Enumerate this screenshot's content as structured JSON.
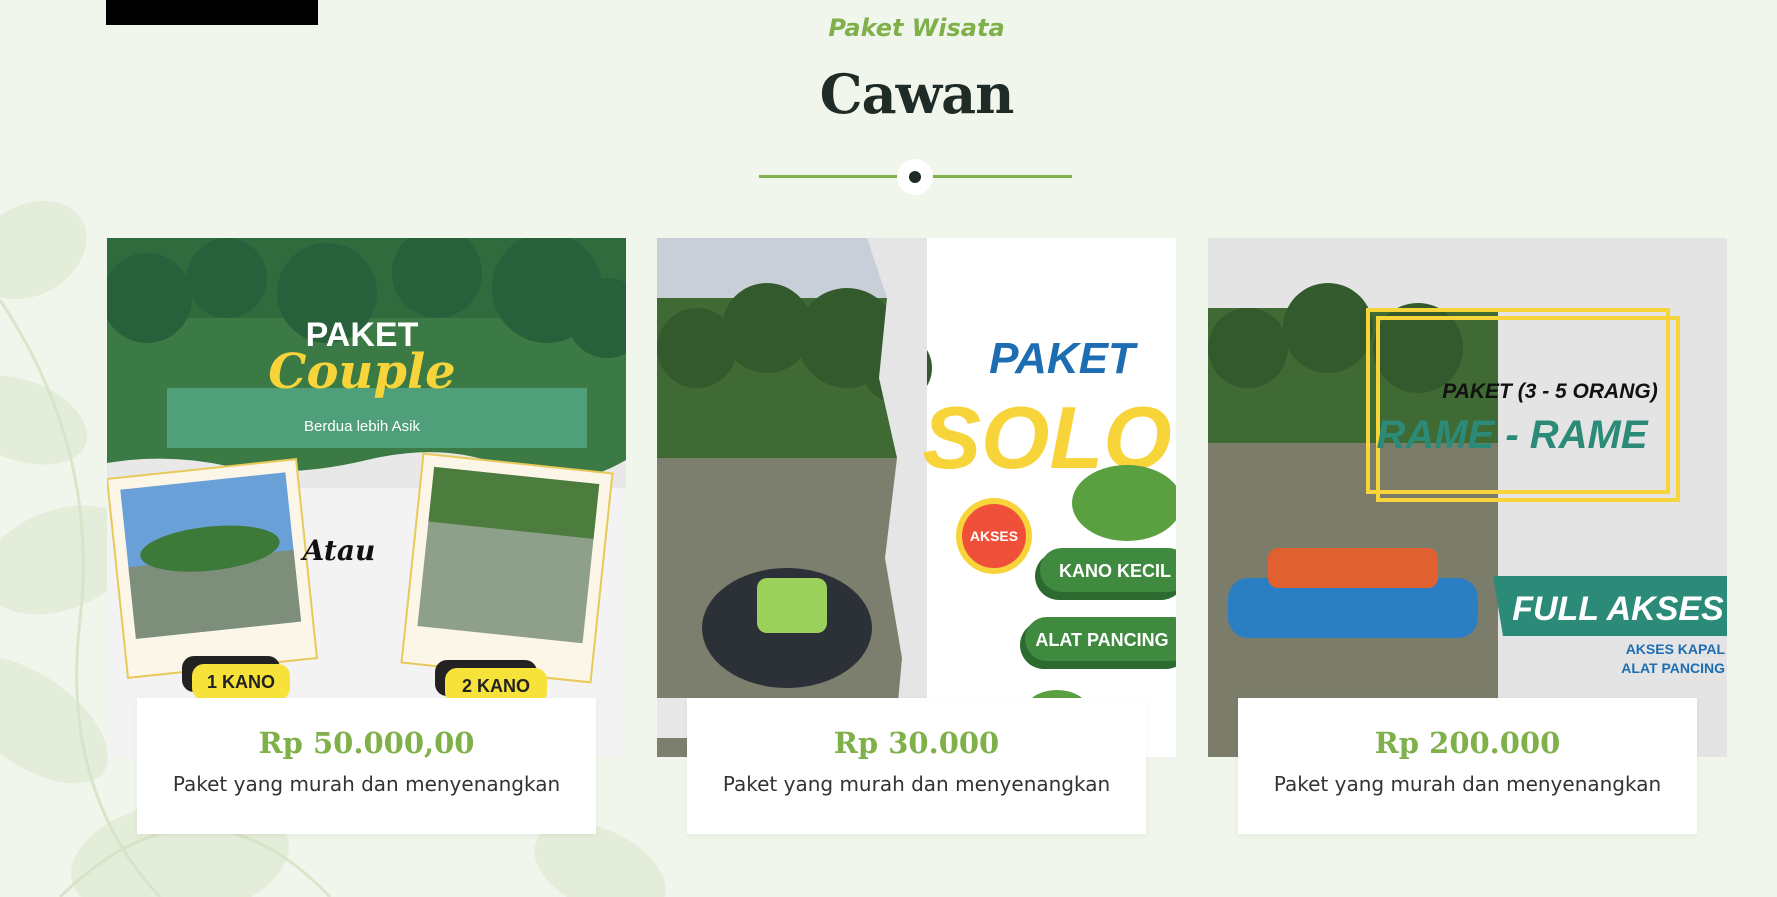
{
  "section": {
    "eyebrow": "Paket Wisata",
    "title": "Cawan"
  },
  "packages": [
    {
      "price": "Rp 50.000,00",
      "description": "Paket yang murah dan menyenangkan",
      "poster": {
        "line1": "PAKET",
        "line2": "Couple",
        "tagline": "Berdua lebih Asik",
        "connector": "Atau",
        "option1": "1 KANO",
        "option2": "2 KANO"
      }
    },
    {
      "price": "Rp 30.000",
      "description": "Paket yang murah dan menyenangkan",
      "poster": {
        "line1": "PAKET",
        "line2": "SOLO",
        "badge": "AKSES",
        "item1": "KANO KECIL",
        "item2": "ALAT PANCING"
      }
    },
    {
      "price": "Rp 200.000",
      "description": "Paket yang murah dan menyenangkan",
      "poster": {
        "line1": "PAKET (3 - 5 ORANG)",
        "line2": "RAME - RAME",
        "banner": "FULL AKSES",
        "item1": "AKSES KAPAL",
        "item2": "ALAT PANCING"
      }
    }
  ],
  "colors": {
    "accent": "#7fb04a",
    "background": "#f1f6ec",
    "heading": "#1f2b27",
    "poster_yellow": "#f7d53a",
    "poster_green": "#3f7d3a",
    "poster_teal": "#2c8a78",
    "poster_blue": "#1d6db3"
  }
}
